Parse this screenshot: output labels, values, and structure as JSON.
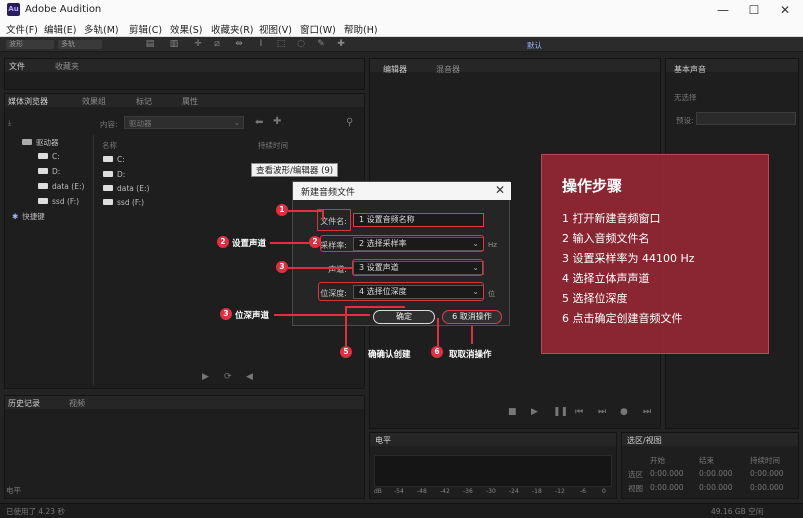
{
  "app": {
    "title": "Adobe Audition",
    "icon_text": "Au"
  },
  "window_controls": {
    "minimize": "—",
    "maximize": "☐",
    "close": "✕"
  },
  "menu": [
    "文件(F)",
    "编辑(E)",
    "多轨(M)",
    "剪辑(C)",
    "效果(S)",
    "收藏夹(R)",
    "视图(V)",
    "窗口(W)",
    "帮助(H)"
  ],
  "toolbar": {
    "waveform": "波形",
    "multitrack": "多轨",
    "workspace": "默认"
  },
  "panels": {
    "files": {
      "tabs": [
        "文件",
        "收藏夹"
      ]
    },
    "media_browser": {
      "tabs": [
        "媒体浏览器",
        "效果组",
        "标记",
        "属性"
      ],
      "content_label": "内容:",
      "content_value": "驱动器",
      "tree_root": "驱动器",
      "tree_items": [
        "C:",
        "D:",
        "data (E:)",
        "ssd (F:)"
      ],
      "shortcuts": "快捷键",
      "name_column": "名称",
      "duration_column": "持续时间",
      "list_items": [
        "C:",
        "D:",
        "data (E:)",
        "ssd (F:)"
      ]
    },
    "editor": {
      "tabs": [
        "编辑器",
        "混音器"
      ]
    },
    "essential_sound": {
      "title": "基本声音",
      "no_selection": "无选择",
      "preset": "预设:"
    },
    "history": {
      "tabs": [
        "历史记录",
        "视频"
      ]
    },
    "levels": {
      "title": "电平",
      "scale": [
        "dB",
        "-54",
        "-48",
        "-42",
        "-36",
        "-30",
        "-24",
        "-18",
        "-12",
        "-6",
        "0"
      ]
    },
    "selection_view": {
      "title": "选区/视图",
      "headers": [
        "开始",
        "结束",
        "持续时间"
      ],
      "rows": [
        {
          "label": "选区",
          "values": [
            "0:00.000",
            "0:00.000",
            "0:00.000"
          ]
        },
        {
          "label": "视图",
          "values": [
            "0:00.000",
            "0:00.000",
            "0:00.000"
          ]
        }
      ]
    }
  },
  "status": {
    "left": "已使用了 4.23 秒",
    "right": "49.16 GB 空闲",
    "level_footer": "电平"
  },
  "tooltip": "查看波形/编辑器 (9)",
  "dialog": {
    "title": "新建音频文件",
    "close": "✕",
    "filename_label": "文件名:",
    "filename_value": "1 设置音频名称",
    "samplerate_label": "采样率:",
    "samplerate_value": "2 选择采样率",
    "samplerate_unit": "Hz",
    "channels_label": "声道:",
    "channels_value": "3 设置声道",
    "bitdepth_label": "位深度:",
    "bitdepth_value": "4 选择位深度",
    "bitdepth_unit": "位",
    "ok": "确定",
    "cancel": "6 取消操作"
  },
  "annotations": {
    "b1": "1",
    "b2": "2",
    "b3a": "3",
    "b3b": "3",
    "b5": "5",
    "b6": "6",
    "set_channel": "设置声道",
    "bitdepth_channel": "位深声道",
    "confirm_create": "确确认创建",
    "cancel_op": "取取消操作"
  },
  "steps": {
    "title": "操作步骤",
    "items": [
      "1  打开新建音频窗口",
      "2  输入音频文件名",
      "3  设置采样率为 44100 Hz",
      "4  选择立体声声道",
      "5  选择位深度",
      "6  点击确定创建音频文件"
    ]
  }
}
